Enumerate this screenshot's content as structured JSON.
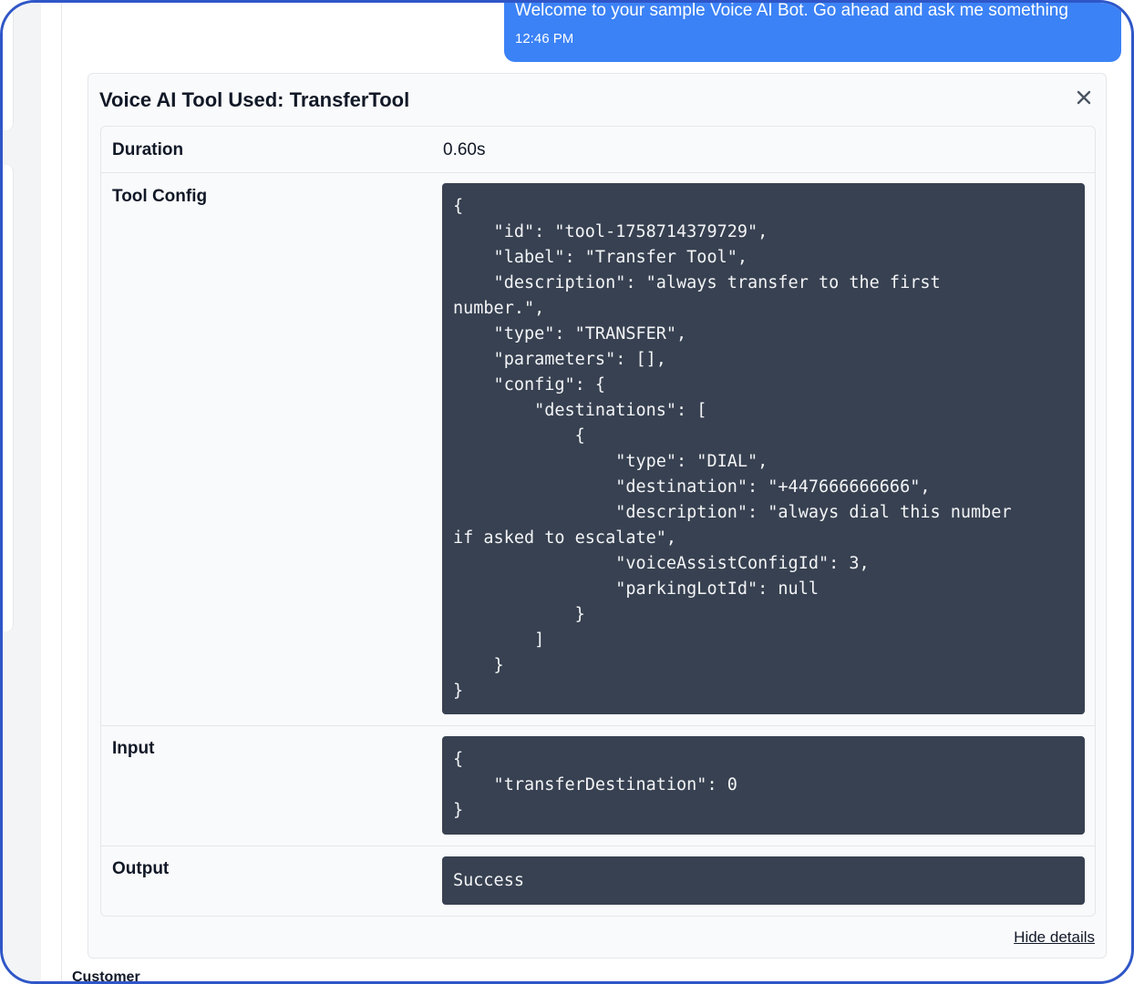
{
  "chat": {
    "bot_message": "Welcome to your sample Voice AI Bot. Go ahead and ask me something",
    "bot_time": "12:46 PM",
    "next_sender": "Customer"
  },
  "tool_card": {
    "title": "Voice AI Tool Used: TransferTool",
    "close_icon": "close-icon",
    "hide_details_label": "Hide details",
    "rows": {
      "duration": {
        "label": "Duration",
        "value": "0.60s"
      },
      "tool_config": {
        "label": "Tool Config",
        "value": "{\n    \"id\": \"tool-1758714379729\",\n    \"label\": \"Transfer Tool\",\n    \"description\": \"always transfer to the first\nnumber.\",\n    \"type\": \"TRANSFER\",\n    \"parameters\": [],\n    \"config\": {\n        \"destinations\": [\n            {\n                \"type\": \"DIAL\",\n                \"destination\": \"+447666666666\",\n                \"description\": \"always dial this number\nif asked to escalate\",\n                \"voiceAssistConfigId\": 3,\n                \"parkingLotId\": null\n            }\n        ]\n    }\n}"
      },
      "input": {
        "label": "Input",
        "value": "{\n    \"transferDestination\": 0\n}"
      },
      "output": {
        "label": "Output",
        "value": "Success"
      }
    }
  },
  "colors": {
    "bubble": "#3b82f6",
    "code_bg": "#374151",
    "frame_border": "#2f56c8"
  }
}
